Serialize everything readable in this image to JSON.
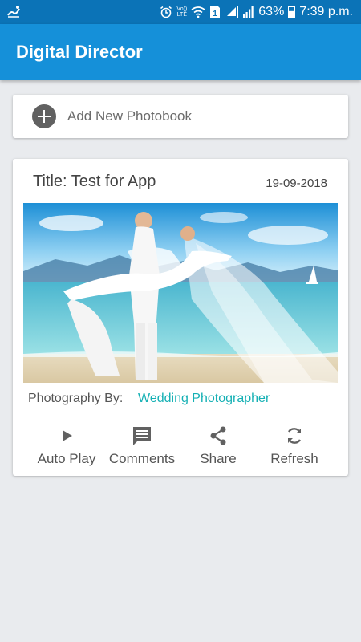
{
  "status_bar": {
    "lte_label_top": "Vo))",
    "lte_label_bottom": "LTE",
    "sim_slot": "1",
    "battery_percent": "63%",
    "battery_level": 0.63,
    "time": "7:39 p.m.",
    "icons": [
      "notification-icon",
      "alarm-icon",
      "volte-icon",
      "wifi-icon",
      "sim-icon",
      "signal-icon",
      "battery-icon"
    ]
  },
  "app_bar": {
    "title": "Digital Director"
  },
  "add_photobook": {
    "label": "Add New Photobook",
    "icon": "add-circle-icon"
  },
  "album": {
    "title": "Title: Test for App",
    "date": "19-09-2018",
    "credit_label": "Photography By:",
    "credit_value": "Wedding Photographer",
    "actions": [
      {
        "label": "Auto Play",
        "icon": "play-icon"
      },
      {
        "label": "Comments",
        "icon": "comment-icon"
      },
      {
        "label": "Share",
        "icon": "share-icon"
      },
      {
        "label": "Refresh",
        "icon": "refresh-icon"
      }
    ]
  },
  "colors": {
    "status_bar": "#0b73b7",
    "app_bar": "#1590d9",
    "accent_link": "#14b0b4",
    "background": "#e9ebee",
    "icon_grey": "#616161"
  }
}
